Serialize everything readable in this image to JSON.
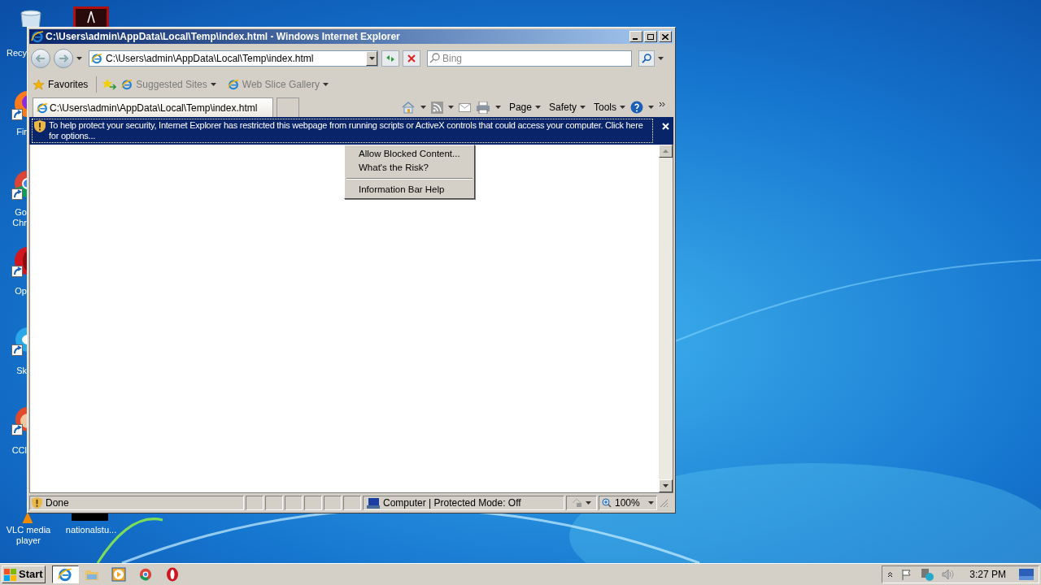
{
  "desktop_icons": [
    {
      "kind": "bin",
      "label": "Recy"
    },
    {
      "kind": "pdf"
    },
    {
      "kind": "fox",
      "label": "Fir"
    },
    {
      "kind": "chrome",
      "label": "Go Chr"
    },
    {
      "kind": "opera",
      "label": "Op"
    },
    {
      "kind": "cloud",
      "label": "Sk"
    },
    {
      "kind": "cleaner",
      "label": "CCl"
    },
    {
      "kind": "cone",
      "label": "VLC media player"
    },
    {
      "kind": "file",
      "label": "nationalstu..."
    }
  ],
  "window": {
    "title": "C:\\Users\\admin\\AppData\\Local\\Temp\\index.html - Windows Internet Explorer",
    "address": "C:\\Users\\admin\\AppData\\Local\\Temp\\index.html",
    "search": {
      "placeholder": "Bing"
    },
    "favorites": {
      "label": "Favorites",
      "links": [
        "Suggested Sites",
        "Web Slice Gallery"
      ]
    },
    "tab": {
      "title": "C:\\Users\\admin\\AppData\\Local\\Temp\\index.html"
    },
    "commands": [
      "Page",
      "Safety",
      "Tools"
    ],
    "info_bar": "To help protect your security, Internet Explorer has restricted this webpage from running scripts or ActiveX controls that could access your computer. Click here for options...",
    "context_menu": [
      [
        "Allow Blocked Content...",
        "What's the Risk?"
      ],
      [
        "Information Bar Help"
      ]
    ],
    "status_bar": {
      "text": "Done",
      "zone": "Computer | Protected Mode: Off",
      "zoom": "100%"
    }
  },
  "taskbar": {
    "start": "Start",
    "apps": [
      {
        "kind": "ie",
        "selected": true
      },
      {
        "kind": "folder",
        "selected": false
      },
      {
        "kind": "player",
        "selected": false
      },
      {
        "kind": "chrome",
        "selected": false
      },
      {
        "kind": "opera",
        "selected": false
      }
    ],
    "clock": "3:27 PM"
  }
}
